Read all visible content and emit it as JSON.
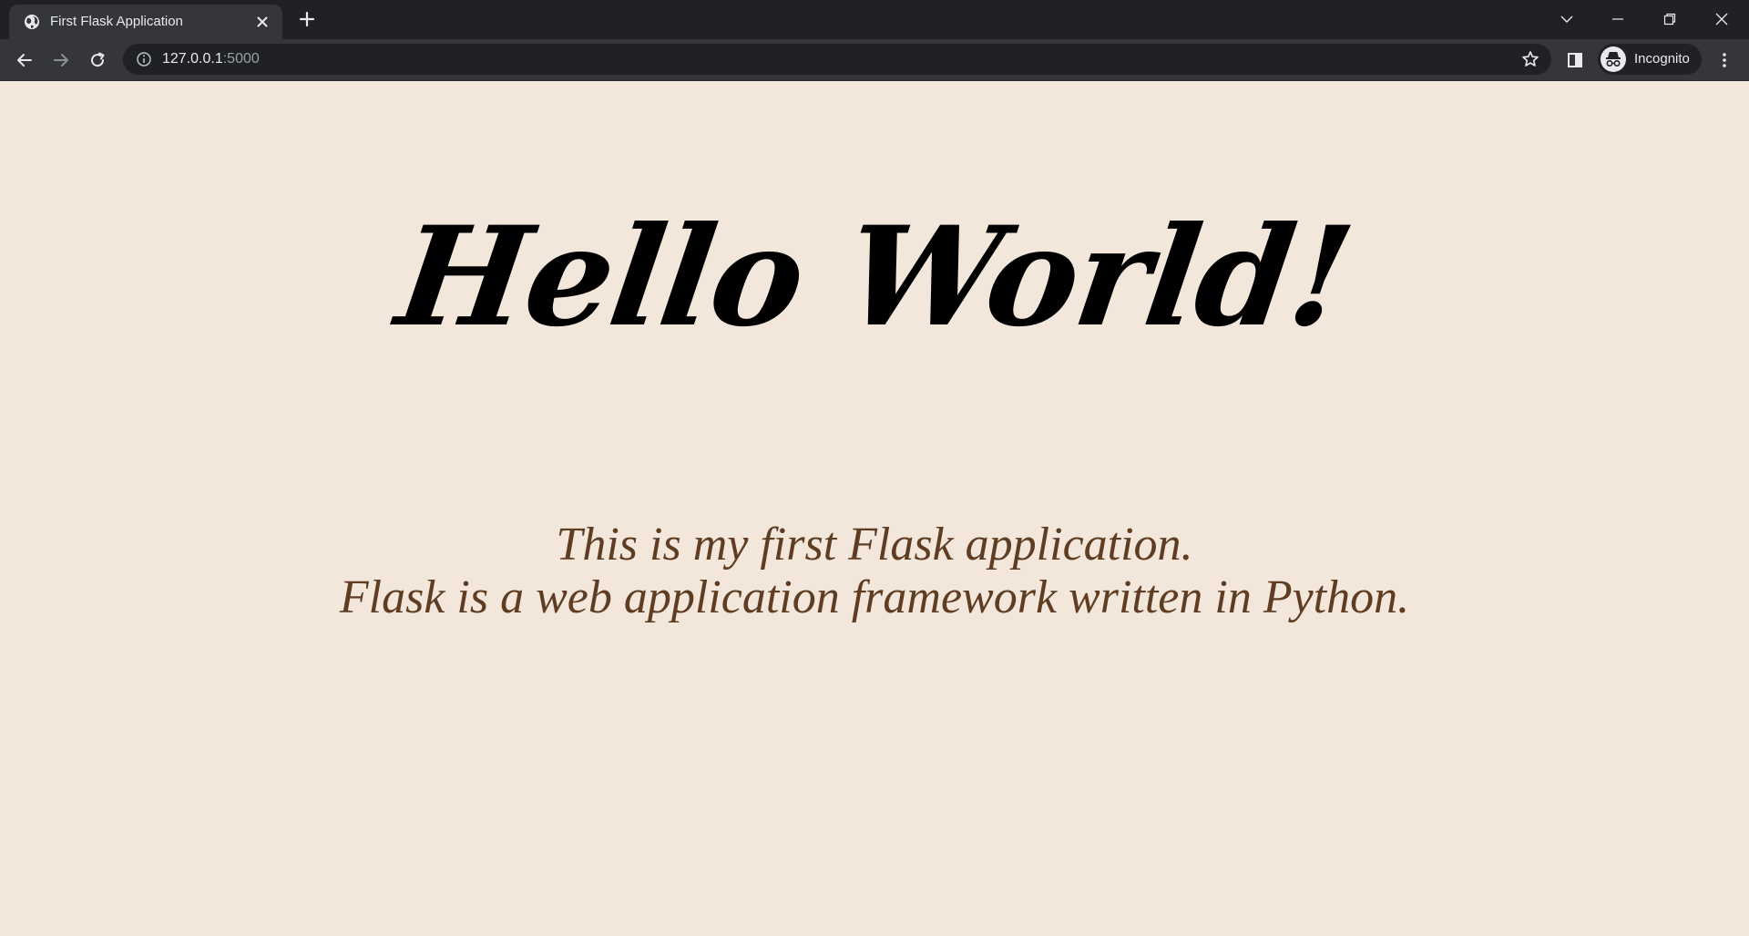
{
  "browser": {
    "tab": {
      "title": "First Flask Application"
    },
    "address_bar": {
      "host": "127.0.0.1",
      "port": ":5000"
    },
    "profile": {
      "label": "Incognito"
    }
  },
  "page": {
    "heading": "Hello World!",
    "description_line1": "This is my first Flask application.",
    "description_line2": "Flask is a web application framework written in Python."
  },
  "icons": [
    "globe-icon",
    "close-icon",
    "plus-icon",
    "chevron-down-icon",
    "minimize-icon",
    "restore-icon",
    "window-close-icon",
    "back-arrow-icon",
    "forward-arrow-icon",
    "reload-icon",
    "info-icon",
    "star-icon",
    "side-panel-icon",
    "incognito-icon",
    "more-vert-icon"
  ],
  "colors": {
    "page_background": "#f3e6da",
    "description_text": "#5e3d22",
    "chrome_dark": "#202124",
    "chrome_toolbar": "#35363a"
  }
}
